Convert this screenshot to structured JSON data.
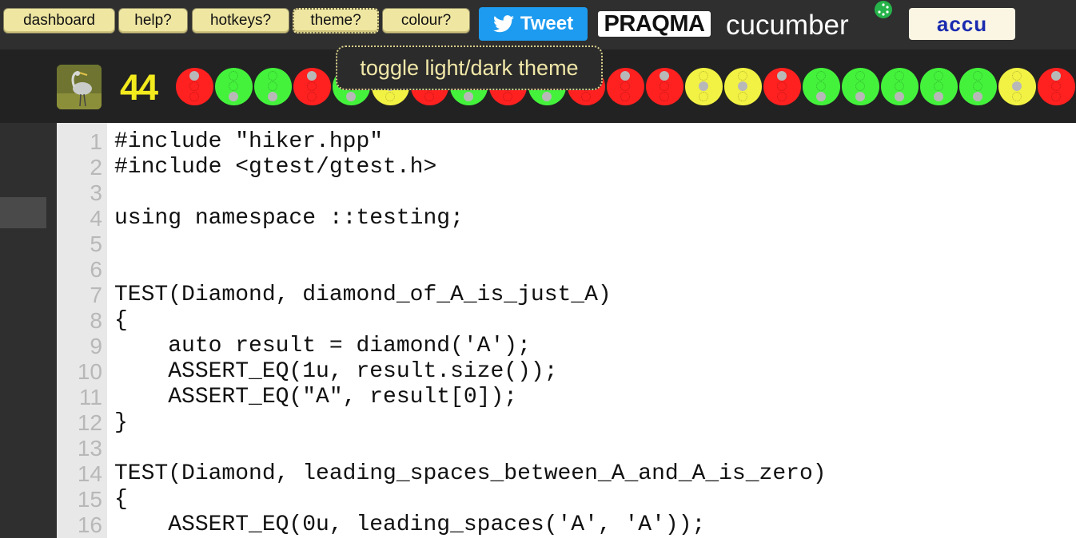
{
  "toolbar": {
    "dashboard_label": "dashboard",
    "help_label": "help?",
    "hotkeys_label": "hotkeys?",
    "theme_label": "theme?",
    "colour_label": "colour?"
  },
  "sponsors": {
    "tweet_label": "Tweet",
    "praqma_label": "PRAQMA",
    "cucumber_label": "cucumber",
    "accu_label": "accu"
  },
  "tooltip": "toggle light/dark theme",
  "traffic": {
    "count": "44",
    "colors": {
      "red": "#ff2020",
      "green": "#44f23c",
      "amber": "#f2f244"
    },
    "lights": [
      "red",
      "green",
      "green",
      "red",
      "green",
      "amber",
      "red",
      "green",
      "red",
      "green",
      "red",
      "red",
      "red",
      "amber",
      "amber",
      "red",
      "green",
      "green",
      "green",
      "green",
      "green",
      "amber",
      "red"
    ]
  },
  "editor": {
    "lines": [
      {
        "n": "1",
        "code": "#include \"hiker.hpp\""
      },
      {
        "n": "2",
        "code": "#include <gtest/gtest.h>"
      },
      {
        "n": "3",
        "code": ""
      },
      {
        "n": "4",
        "code": "using namespace ::testing;"
      },
      {
        "n": "5",
        "code": ""
      },
      {
        "n": "6",
        "code": ""
      },
      {
        "n": "7",
        "code": "TEST(Diamond, diamond_of_A_is_just_A)"
      },
      {
        "n": "8",
        "code": "{"
      },
      {
        "n": "9",
        "code": "    auto result = diamond('A');"
      },
      {
        "n": "10",
        "code": "    ASSERT_EQ(1u, result.size());"
      },
      {
        "n": "11",
        "code": "    ASSERT_EQ(\"A\", result[0]);"
      },
      {
        "n": "12",
        "code": "}"
      },
      {
        "n": "13",
        "code": ""
      },
      {
        "n": "14",
        "code": "TEST(Diamond, leading_spaces_between_A_and_A_is_zero)"
      },
      {
        "n": "15",
        "code": "{"
      },
      {
        "n": "16",
        "code": "    ASSERT_EQ(0u, leading_spaces('A', 'A'));"
      }
    ]
  }
}
